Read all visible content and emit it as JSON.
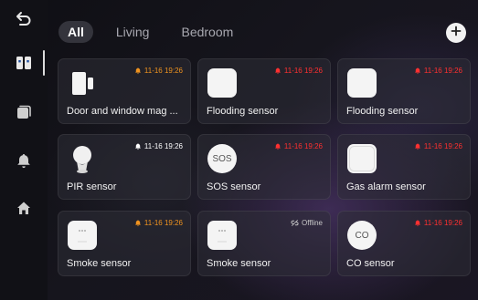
{
  "nav": {
    "back_icon": "back-arrow-icon",
    "items": [
      {
        "name": "devices",
        "icon": "devices-icon",
        "active": true
      },
      {
        "name": "scenes",
        "icon": "stacked-cards-icon",
        "active": false
      },
      {
        "name": "alarms",
        "icon": "bell-icon",
        "active": false
      },
      {
        "name": "home",
        "icon": "home-icon",
        "active": false
      }
    ]
  },
  "tabs": [
    {
      "label": "All",
      "active": true
    },
    {
      "label": "Living",
      "active": false
    },
    {
      "label": "Bedroom",
      "active": false
    }
  ],
  "add_icon": "plus-icon",
  "colors": {
    "alarm_orange": "#f0931f",
    "alarm_red": "#ff3030",
    "normal_white": "#ffffff",
    "offline_gray": "#c8c8c8"
  },
  "devices": [
    {
      "name": "Door and window mag ...",
      "icon": "door-window-sensor-icon",
      "status_icon": "bell-icon",
      "status_text": "11-16 19:26",
      "status_color": "#f0931f"
    },
    {
      "name": "Flooding sensor",
      "icon": "flooding-sensor-icon",
      "status_icon": "bell-icon",
      "status_text": "11-16 19:26",
      "status_color": "#ff3030"
    },
    {
      "name": "Flooding sensor",
      "icon": "flooding-sensor-icon",
      "status_icon": "bell-icon",
      "status_text": "11-16 19:26",
      "status_color": "#ff3030"
    },
    {
      "name": "PIR sensor",
      "icon": "pir-sensor-icon",
      "status_icon": "bell-icon",
      "status_text": "11-16 19:26",
      "status_color": "#ffffff"
    },
    {
      "name": "SOS sensor",
      "icon": "sos-button-icon",
      "icon_text": "SOS",
      "status_icon": "bell-icon",
      "status_text": "11-16 19:26",
      "status_color": "#ff3030"
    },
    {
      "name": "Gas alarm sensor",
      "icon": "gas-alarm-icon",
      "status_icon": "bell-icon",
      "status_text": "11-16 19:26",
      "status_color": "#ff3030"
    },
    {
      "name": "Smoke sensor",
      "icon": "smoke-sensor-icon",
      "status_icon": "bell-icon",
      "status_text": "11-16 19:26",
      "status_color": "#f0931f"
    },
    {
      "name": "Smoke sensor",
      "icon": "smoke-sensor-icon",
      "status_icon": "offline-link-icon",
      "status_text": "Offline",
      "status_color": "#c8c8c8"
    },
    {
      "name": "CO sensor",
      "icon": "co-sensor-icon",
      "icon_text": "CO",
      "status_icon": "bell-icon",
      "status_text": "11-16 19:26",
      "status_color": "#ff3030"
    }
  ]
}
